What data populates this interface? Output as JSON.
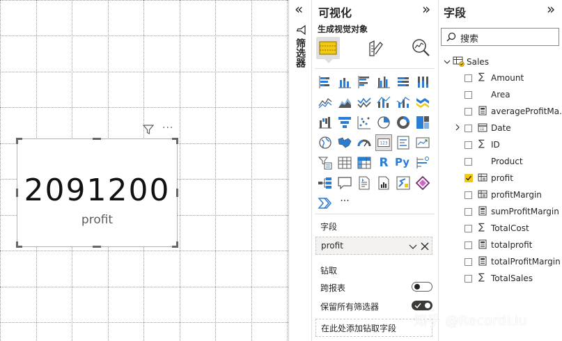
{
  "canvas": {
    "card": {
      "value": "2091200",
      "label": "profit"
    },
    "card_more": "···"
  },
  "filters": {
    "label": "筛选器"
  },
  "viz_pane": {
    "title": "可视化",
    "collapse_glyph": "»",
    "build_label": "生成视觉对象",
    "more_visuals": "···",
    "fields_label": "字段",
    "field_value": "profit",
    "drill_label": "钻取",
    "cross_report_label": "跨报表",
    "cross_report_on": false,
    "keep_filters_label": "保留所有筛选器",
    "keep_filters_on": true,
    "drill_placeholder": "在此处添加钻取字段"
  },
  "filter_strip": {
    "collapse_glyph": "«"
  },
  "fields_pane": {
    "title": "字段",
    "collapse_glyph": "»",
    "search_placeholder": "搜索",
    "table_name": "Sales",
    "fields": [
      {
        "name": "Amount",
        "icon": "sigma",
        "checked": false
      },
      {
        "name": "Area",
        "icon": "none",
        "checked": false
      },
      {
        "name": "averageProfitMa...",
        "icon": "calculator",
        "checked": false
      },
      {
        "name": "Date",
        "icon": "calendar",
        "checked": false,
        "expandable": true
      },
      {
        "name": "ID",
        "icon": "sigma",
        "checked": false
      },
      {
        "name": "Product",
        "icon": "none",
        "checked": false
      },
      {
        "name": "profit",
        "icon": "table-calc",
        "checked": true
      },
      {
        "name": "profitMargin",
        "icon": "table-calc",
        "checked": false
      },
      {
        "name": "sumProfitMargin",
        "icon": "calculator",
        "checked": false
      },
      {
        "name": "TotalCost",
        "icon": "sigma",
        "checked": false
      },
      {
        "name": "totalprofit",
        "icon": "calculator",
        "checked": false
      },
      {
        "name": "totalProfitMargin",
        "icon": "calculator",
        "checked": false
      },
      {
        "name": "TotalSales",
        "icon": "sigma",
        "checked": false
      }
    ]
  },
  "watermark": "知乎 @RecordLiu",
  "colors": {
    "accent_yellow": "#f2c811",
    "selected_bg": "#e1dfdd",
    "blue_icon": "#2b7cd3",
    "text": "#252423"
  }
}
